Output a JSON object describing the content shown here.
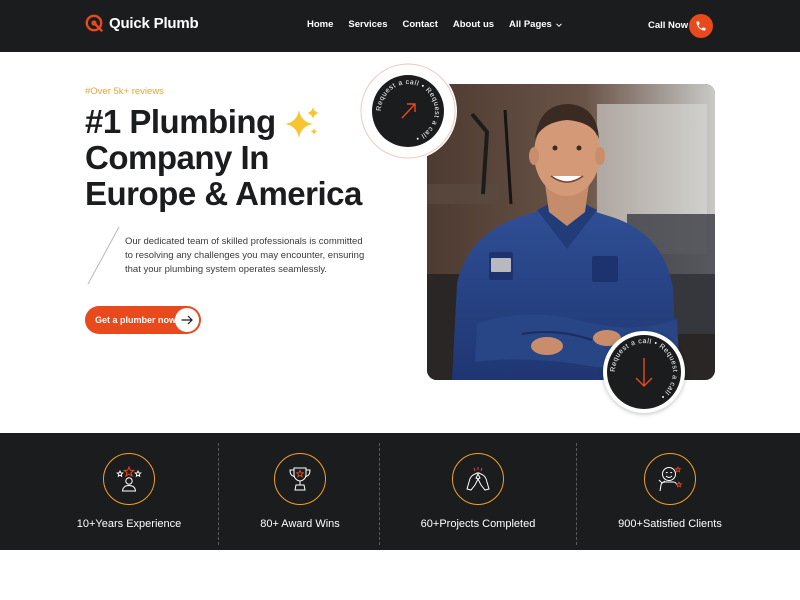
{
  "nav": {
    "brand": "Quick Plumb",
    "items": [
      {
        "label": "Home"
      },
      {
        "label": "Services"
      },
      {
        "label": "Contact"
      },
      {
        "label": "About us"
      },
      {
        "label": "All Pages"
      }
    ],
    "call_label": "Call Now"
  },
  "hero": {
    "tag": "#Over 5k+ reviews",
    "title_lines": [
      "#1 Plumbing",
      "Company In",
      "Europe & America"
    ],
    "description": "Our dedicated team of skilled professionals is committed to resolving any challenges you may encounter, ensuring that your plumbing system operates seamlessly.",
    "cta_label": "Get a plumber now",
    "badge_text": "Request a call • Request a call •"
  },
  "stats": [
    {
      "label": "10+Years Experience",
      "icon": "star-person-icon"
    },
    {
      "label": "80+ Award Wins",
      "icon": "trophy-icon"
    },
    {
      "label": "60+Projects Completed",
      "icon": "high-five-icon"
    },
    {
      "label": "900+Satisfied Clients",
      "icon": "happy-client-icon"
    }
  ],
  "colors": {
    "accent": "#e8491d",
    "gold": "#f3a11f",
    "dark": "#1b1c1e",
    "tag": "#e8a33d"
  }
}
